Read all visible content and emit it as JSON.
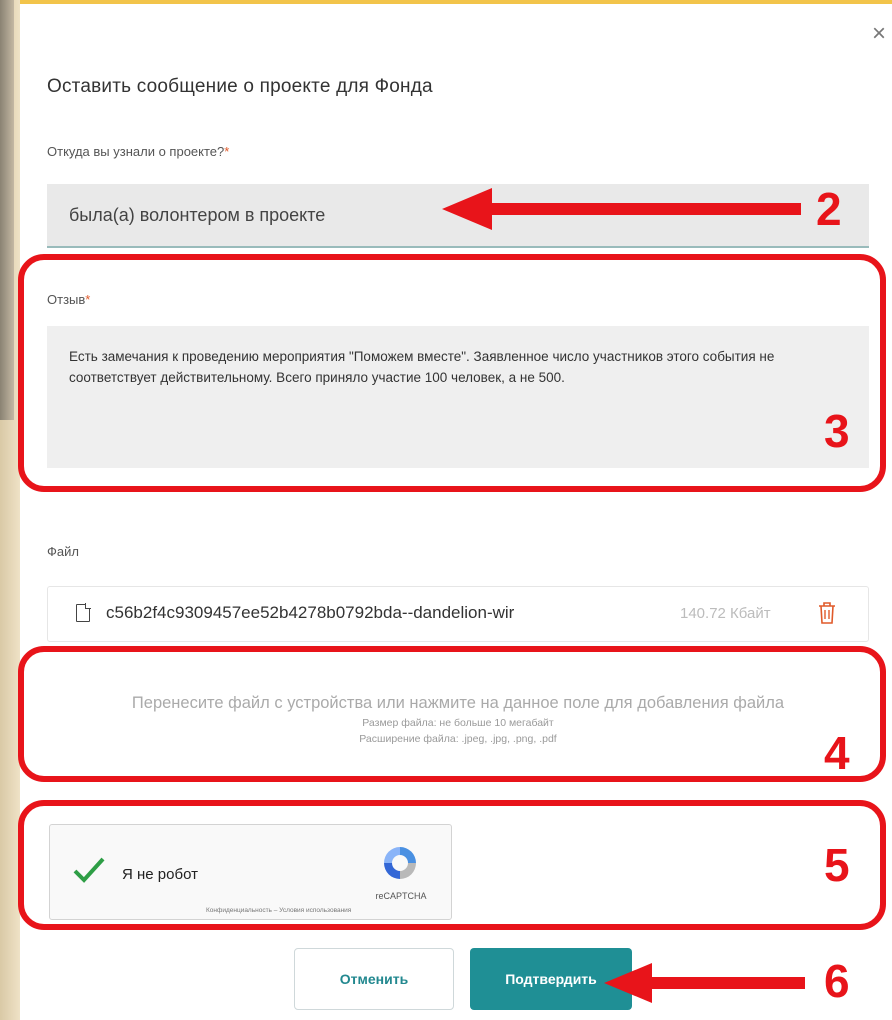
{
  "modal": {
    "title": "Оставить сообщение о проекте для Фонда",
    "close_label": "×"
  },
  "source_field": {
    "label": "Откуда вы узнали о проекте?",
    "required_mark": "*",
    "value": "была(а) волонтером в проекте"
  },
  "review_field": {
    "label": "Отзыв",
    "required_mark": "*",
    "value": "Есть замечания к проведению мероприятия \"Поможем вместе\". Заявленное число участников этого события не соответствует действительному. Всего приняло участие 100 человек, а не 500."
  },
  "file_section": {
    "label": "Файл",
    "file_name": "c56b2f4c9309457ee52b4278b0792bda--dandelion-wir",
    "file_size": "140.72 Кбайт",
    "icons": {
      "file": "file-icon",
      "delete": "trash-icon"
    }
  },
  "dropzone": {
    "main_text": "Перенесите файл с устройства или нажмите на данное поле для добавления файла",
    "size_hint": "Размер файла: не больше 10 мегабайт",
    "ext_hint": "Расширение файла: .jpeg, .jpg, .png, .pdf"
  },
  "captcha": {
    "label": "Я не робот",
    "brand": "reCAPTCHA",
    "terms": "Конфиденциальность – Условия использования",
    "checked": true
  },
  "buttons": {
    "cancel": "Отменить",
    "confirm": "Подтвердить"
  },
  "annotations": {
    "n2": "2",
    "n3": "3",
    "n4": "4",
    "n5": "5",
    "n6": "6",
    "color": "#e8141a"
  },
  "colors": {
    "accent": "#1f8f95",
    "top_border": "#f2c44a",
    "required": "#e05a2a"
  }
}
